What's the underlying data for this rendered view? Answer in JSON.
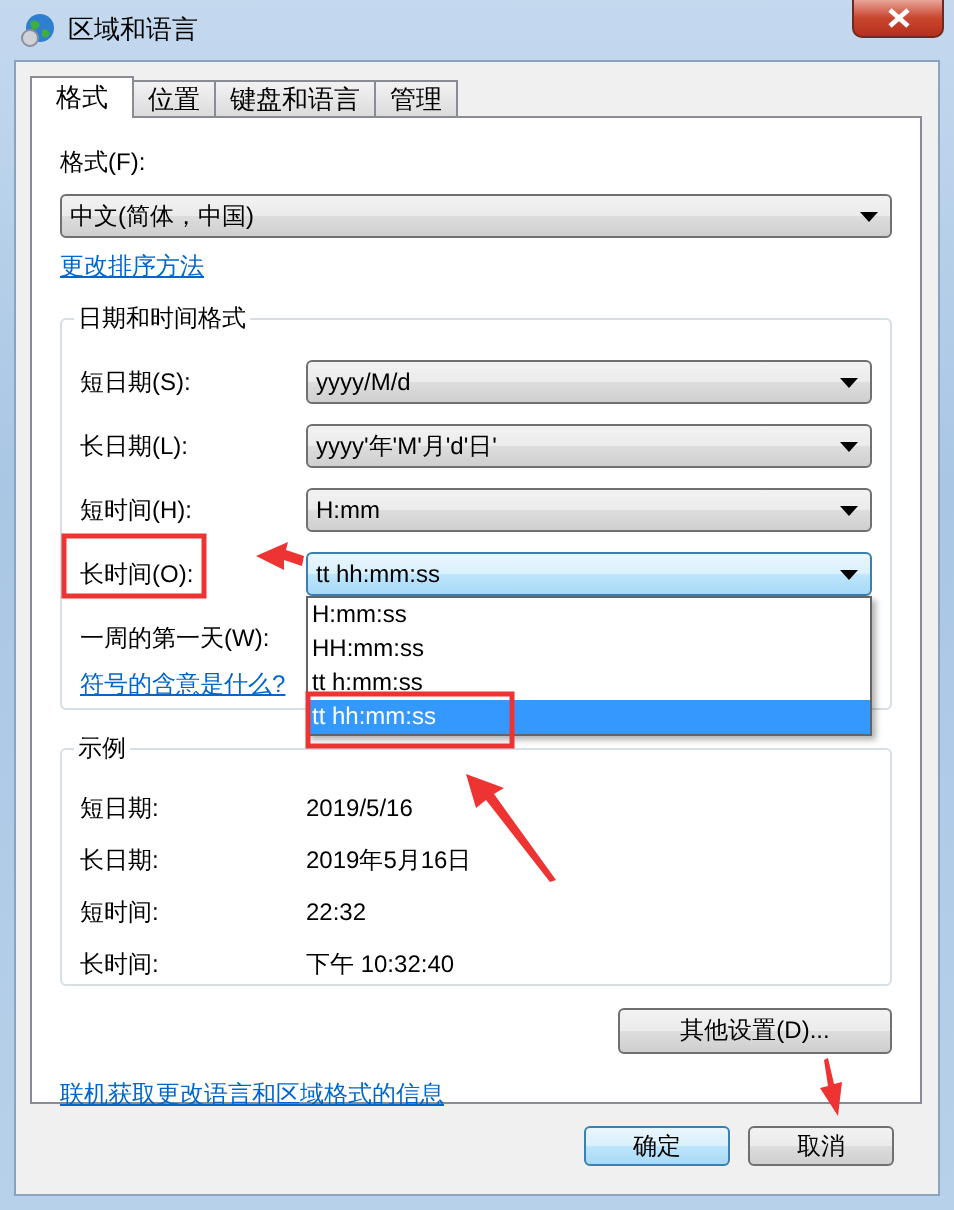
{
  "window": {
    "title": "区域和语言"
  },
  "tabs": [
    {
      "label": "格式",
      "selected": true
    },
    {
      "label": "位置",
      "selected": false
    },
    {
      "label": "键盘和语言",
      "selected": false
    },
    {
      "label": "管理",
      "selected": false
    }
  ],
  "format": {
    "label": "格式(F):",
    "value": "中文(简体，中国)"
  },
  "sort_link": "更改排序方法",
  "date_time_group": {
    "title": "日期和时间格式",
    "fields": [
      {
        "label": "短日期(S):",
        "value": "yyyy/M/d",
        "expanded": false
      },
      {
        "label": "长日期(L):",
        "value": "yyyy'年'M'月'd'日'",
        "expanded": false
      },
      {
        "label": "短时间(H):",
        "value": "H:mm",
        "expanded": false
      },
      {
        "label": "长时间(O):",
        "value": "tt hh:mm:ss",
        "expanded": true,
        "options": [
          {
            "label": "H:mm:ss",
            "selected": false
          },
          {
            "label": "HH:mm:ss",
            "selected": false
          },
          {
            "label": "tt h:mm:ss",
            "selected": false
          },
          {
            "label": "tt hh:mm:ss",
            "selected": true
          }
        ]
      }
    ],
    "first_day_label": "一周的第一天(W):",
    "symbols_link": "符号的含意是什么?"
  },
  "example_group": {
    "title": "示例",
    "rows": [
      {
        "label": "短日期:",
        "value": "2019/5/16"
      },
      {
        "label": "长日期:",
        "value": "2019年5月16日"
      },
      {
        "label": "短时间:",
        "value": "22:32"
      },
      {
        "label": "长时间:",
        "value": "下午 10:32:40"
      }
    ]
  },
  "additional_settings_button": "其他设置(D)...",
  "online_link": "联机获取更改语言和区域格式的信息",
  "buttons": [
    {
      "label": "确定",
      "default": true
    },
    {
      "label": "取消",
      "default": false
    }
  ]
}
